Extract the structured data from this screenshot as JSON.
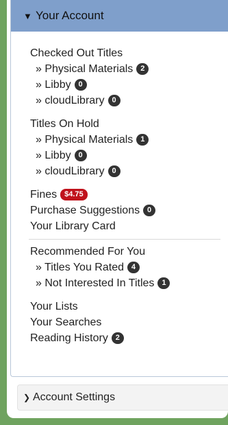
{
  "account": {
    "header": "Your Account",
    "checked_out": {
      "label": "Checked Out Titles",
      "items": [
        {
          "label": "» Physical Materials",
          "count": "2"
        },
        {
          "label": "» Libby",
          "count": "0"
        },
        {
          "label": "» cloudLibrary",
          "count": "0"
        }
      ]
    },
    "on_hold": {
      "label": "Titles On Hold",
      "items": [
        {
          "label": "» Physical Materials",
          "count": "1"
        },
        {
          "label": "» Libby",
          "count": "0"
        },
        {
          "label": "» cloudLibrary",
          "count": "0"
        }
      ]
    },
    "fines": {
      "label": "Fines",
      "amount": "$4.75"
    },
    "purchase_suggestions": {
      "label": "Purchase Suggestions",
      "count": "0"
    },
    "library_card": "Your Library Card",
    "recommended": {
      "label": "Recommended For You",
      "items": [
        {
          "label": "» Titles You Rated",
          "count": "4"
        },
        {
          "label": "» Not Interested In Titles",
          "count": "1"
        }
      ]
    },
    "your_lists": "Your Lists",
    "your_searches": "Your Searches",
    "reading_history": {
      "label": "Reading History",
      "count": "2"
    }
  },
  "settings": {
    "header": "Account Settings"
  },
  "colors": {
    "header_bg": "#7f9fcb",
    "fines_badge": "#c0121c",
    "badge": "#333333",
    "frame": "#6fa35f"
  }
}
